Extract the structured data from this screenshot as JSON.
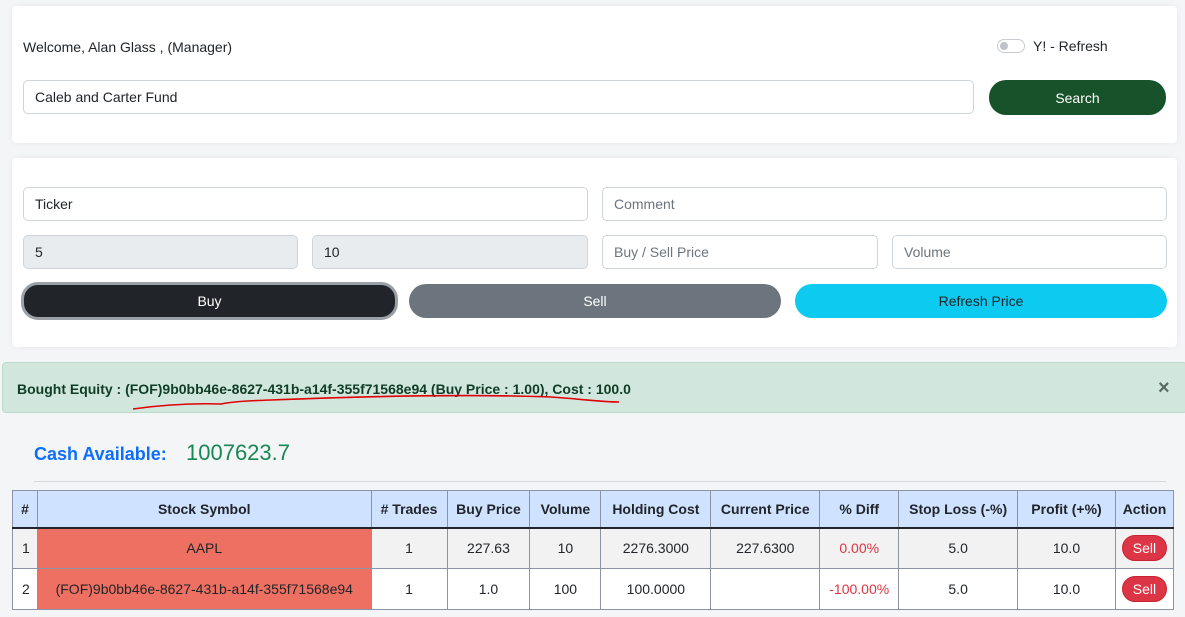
{
  "header": {
    "welcome_text": "Welcome, Alan Glass , (Manager)",
    "refresh_toggle_label": "Y! - Refresh",
    "fund_search_value": "Caleb and Carter Fund",
    "search_button_label": "Search"
  },
  "trade_form": {
    "ticker_placeholder": "Ticker",
    "comment_placeholder": "Comment",
    "stop_loss_value": "5",
    "profit_value": "10",
    "price_placeholder": "Buy / Sell Price",
    "volume_placeholder": "Volume",
    "buy_label": "Buy",
    "sell_label": "Sell",
    "refresh_price_label": "Refresh Price"
  },
  "alert": {
    "message": "Bought Equity : (FOF)9b0bb46e-8627-431b-a14f-355f71568e94 (Buy Price : 1.00), Cost : 100.0",
    "close_symbol": "×"
  },
  "cash": {
    "label": "Cash Available:",
    "value": "1007623.7"
  },
  "table": {
    "headers": [
      "#",
      "Stock Symbol",
      "# Trades",
      "Buy Price",
      "Volume",
      "Holding Cost",
      "Current Price",
      "% Diff",
      "Stop Loss (-%)",
      "Profit (+%)",
      "Action"
    ],
    "rows": [
      {
        "num": "1",
        "symbol": "AAPL",
        "trades": "1",
        "buy_price": "227.63",
        "volume": "10",
        "holding_cost": "2276.3000",
        "current_price": "227.6300",
        "diff": "0.00%",
        "stop_loss": "5.0",
        "profit": "10.0",
        "action": "Sell"
      },
      {
        "num": "2",
        "symbol": "(FOF)9b0bb46e-8627-431b-a14f-355f71568e94",
        "trades": "1",
        "buy_price": "1.0",
        "volume": "100",
        "holding_cost": "100.0000",
        "current_price": "",
        "diff": "-100.00%",
        "stop_loss": "5.0",
        "profit": "10.0",
        "action": "Sell"
      }
    ]
  },
  "colors": {
    "search_button": "#17522a",
    "buy_button": "#212529",
    "sell_button": "#6c757d",
    "refresh_button": "#0dcaf0",
    "alert_bg": "#d1e7dd",
    "cash_label": "#0d6efd",
    "cash_value": "#198754",
    "symbol_cell": "#ee7062",
    "annotation": "#e00000"
  }
}
